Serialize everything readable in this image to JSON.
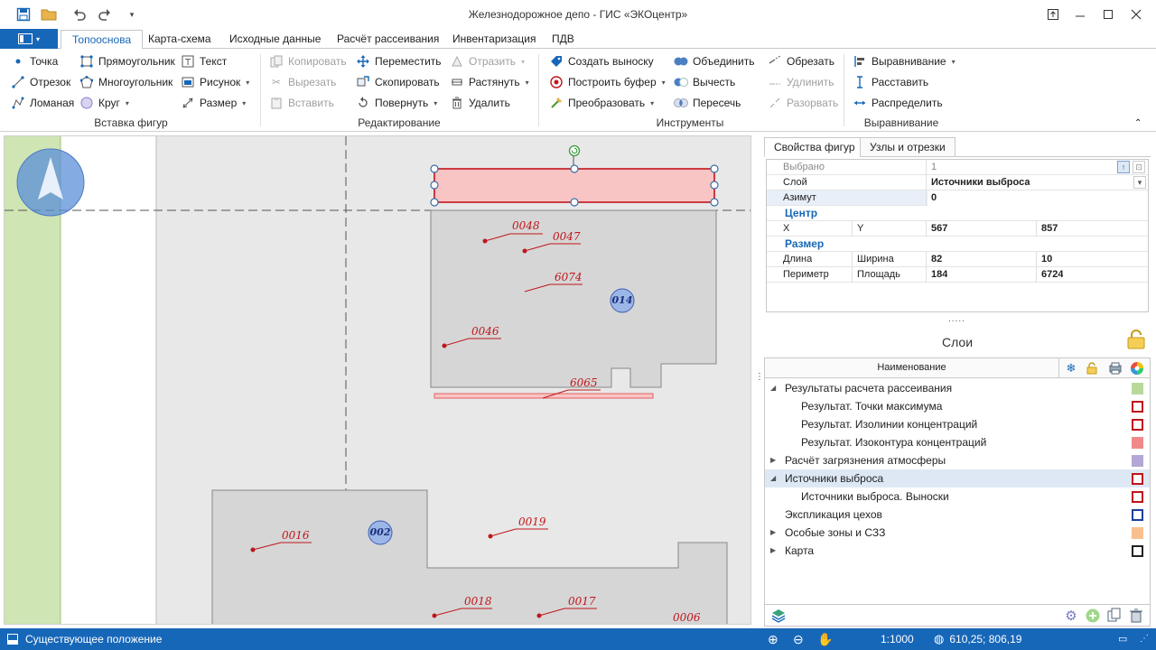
{
  "app": {
    "title": "Железнодорожное депо - ГИС «ЭКОцентр»"
  },
  "tabs": [
    "Топооснова",
    "Карта-схема",
    "Исходные данные",
    "Расчёт рассеивания",
    "Инвентаризация",
    "ПДВ"
  ],
  "ribbon": {
    "insert": {
      "point": "Точка",
      "segment": "Отрезок",
      "polyline": "Ломаная",
      "rectangle": "Прямоугольник",
      "polygon": "Многоугольник",
      "circle": "Круг",
      "text": "Текст",
      "picture": "Рисунок",
      "size": "Размер",
      "group_label": "Вставка фигур"
    },
    "edit": {
      "copy": "Копировать",
      "cut": "Вырезать",
      "paste": "Вставить",
      "move": "Переместить",
      "duplicate": "Скопировать",
      "rotate": "Повернуть",
      "mirror": "Отразить",
      "stretch": "Растянуть",
      "delete": "Удалить",
      "group_label": "Редактирование"
    },
    "tools": {
      "callout": "Создать выноску",
      "buffer": "Построить буфер",
      "convert": "Преобразовать",
      "union": "Объединить",
      "subtract": "Вычесть",
      "intersect": "Пересечь",
      "trim": "Обрезать",
      "extend": "Удлинить",
      "split": "Разорвать",
      "group_label": "Инструменты"
    },
    "align": {
      "align": "Выравнивание",
      "arrange": "Расставить",
      "distribute": "Распределить",
      "group_label": "Выравнивание"
    }
  },
  "map": {
    "labels": [
      "0048",
      "0047",
      "6074",
      "0046",
      "6065",
      "0016",
      "0019",
      "0018",
      "0017",
      "0006"
    ],
    "badges": [
      "014",
      "002"
    ]
  },
  "properties": {
    "tabs": [
      "Свойства фигур",
      "Узлы и отрезки"
    ],
    "selected_label": "Выбрано",
    "selected_value": "1",
    "layer_label": "Слой",
    "layer_value": "Источники выброса",
    "azimuth_label": "Азимут",
    "azimuth_value": "0",
    "center_header": "Центр",
    "x_label": "X",
    "y_label": "Y",
    "x_value": "567",
    "y_value": "857",
    "size_header": "Размер",
    "length_label": "Длина",
    "width_label": "Ширина",
    "length_value": "82",
    "width_value": "10",
    "perimeter_label": "Периметр",
    "area_label": "Площадь",
    "perimeter_value": "184",
    "area_value": "6724"
  },
  "layers": {
    "title": "Слои",
    "column_header": "Наименование",
    "items": [
      {
        "name": "Результаты расчета рассеивания",
        "color": "#b9d99a"
      },
      {
        "name": "Результат. Точки максимума",
        "color": "#c0151b"
      },
      {
        "name": "Результат. Изолинии концентраций",
        "color": "#c0151b"
      },
      {
        "name": "Результат. Изоконтура концентраций",
        "color": "#f08a8a"
      },
      {
        "name": "Расчёт загрязнения атмосферы",
        "color": "#b4a7d6"
      },
      {
        "name": "Источники выброса",
        "color": "#c0151b"
      },
      {
        "name": "Источники выброса. Выноски",
        "color": "#c0151b"
      },
      {
        "name": "Экспликация цехов",
        "color": "#1a3fa0"
      },
      {
        "name": "Особые зоны и СЗЗ",
        "color": "#f9c08f"
      },
      {
        "name": "Карта",
        "color": "#222222"
      }
    ]
  },
  "status": {
    "state": "Существующее положение",
    "scale": "1:1000",
    "coords": "610,25; 806,19"
  }
}
